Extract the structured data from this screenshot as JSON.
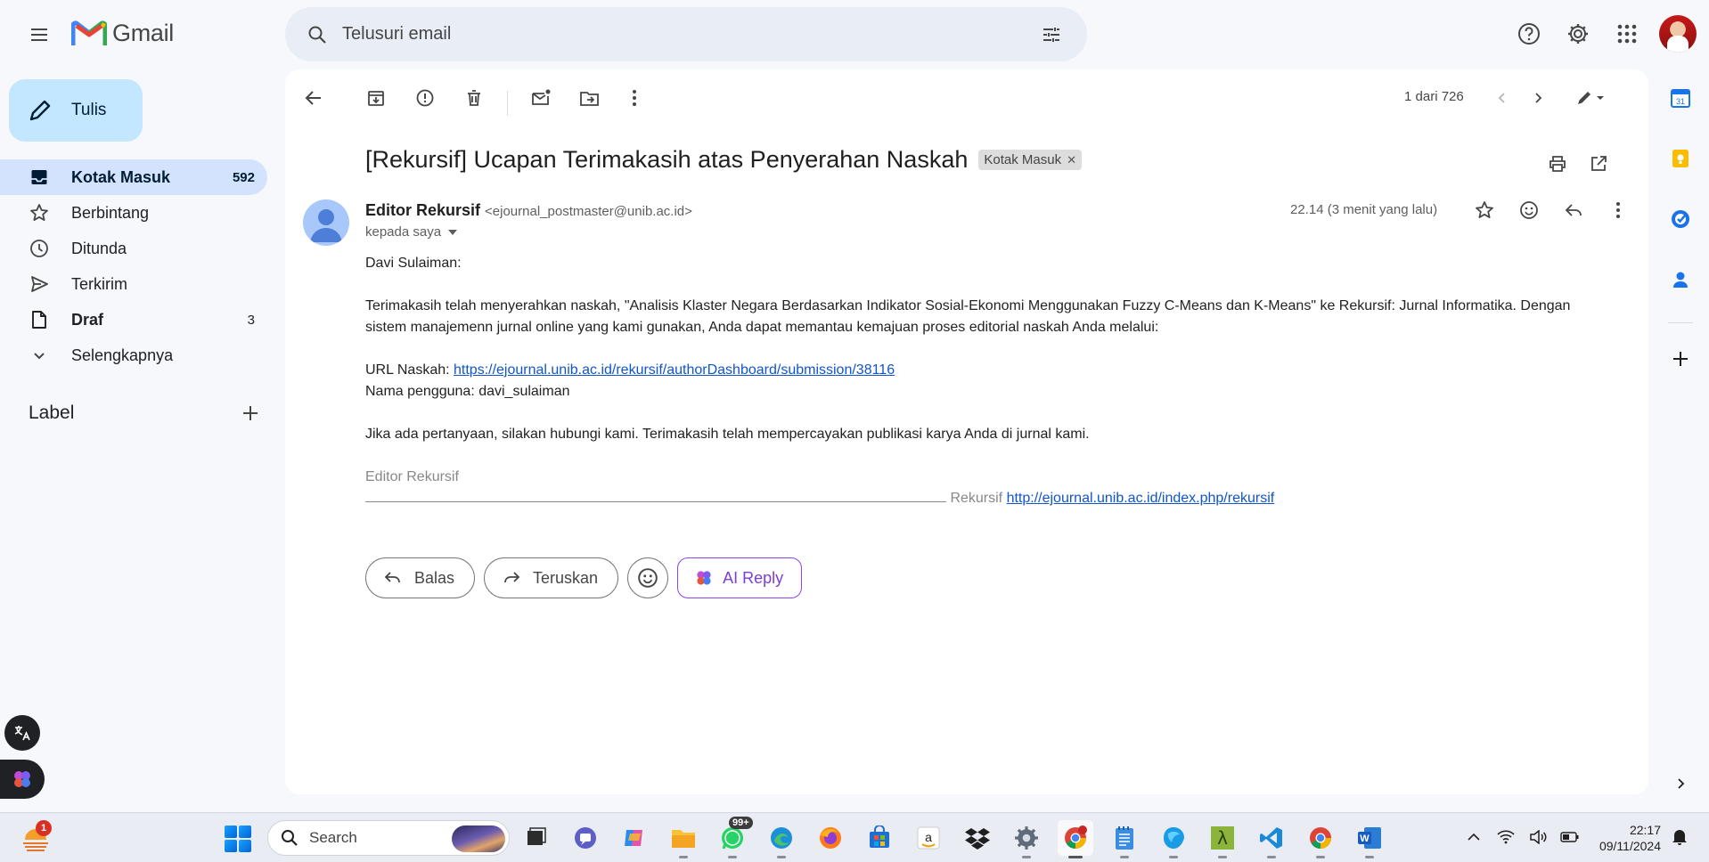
{
  "app": {
    "logo_text": "Gmail"
  },
  "search": {
    "placeholder": "Telusuri email"
  },
  "compose": {
    "label": "Tulis"
  },
  "sidebar": {
    "items": [
      {
        "label": "Kotak Masuk",
        "count": "592",
        "icon": "inbox-icon"
      },
      {
        "label": "Berbintang",
        "count": "",
        "icon": "star-icon"
      },
      {
        "label": "Ditunda",
        "count": "",
        "icon": "clock-icon"
      },
      {
        "label": "Terkirim",
        "count": "",
        "icon": "send-icon"
      },
      {
        "label": "Draf",
        "count": "3",
        "icon": "draft-icon"
      },
      {
        "label": "Selengkapnya",
        "count": "",
        "icon": "chevron-down-icon"
      }
    ],
    "label_header": "Label"
  },
  "toolbar": {
    "pager": "1 dari 726"
  },
  "email": {
    "subject": "[Rekursif] Ucapan Terimakasih atas Penyerahan Naskah",
    "label_chip": "Kotak Masuk",
    "sender_name": "Editor Rekursif",
    "sender_email": "<ejournal_postmaster@unib.ac.id>",
    "to": "kepada saya",
    "time": "22.14 (3 menit yang lalu)",
    "greeting": "Davi Sulaiman:",
    "paragraph1": "Terimakasih telah menyerahkan naskah, \"Analisis Klaster Negara Berdasarkan Indikator Sosial-Ekonomi Menggunakan Fuzzy C-Means dan K-Means\" ke Rekursif: Jurnal Informatika. Dengan sistem manajemenn jurnal online yang kami gunakan, Anda dapat memantau kemajuan proses editorial naskah Anda melalui:",
    "url_label": "URL Naskah: ",
    "url": "https://ejournal.unib.ac.id/rekursif/authorDashboard/submission/38116",
    "username_line": "Nama pengguna: davi_sulaiman",
    "paragraph2": "Jika ada pertanyaan, silakan hubungi kami. Terimakasih telah mempercayakan publikasi karya Anda di jurnal kami.",
    "signature": "Editor Rekursif",
    "footer_label": " Rekursif ",
    "footer_url": "http://ejournal.unib.ac.id/index.php/rekursif"
  },
  "reply_buttons": {
    "reply": "Balas",
    "forward": "Teruskan",
    "ai_reply": "AI Reply"
  },
  "taskbar": {
    "search_label": "Search",
    "weather_badge": "1",
    "whatsapp_badge": "99+",
    "time": "22:17",
    "date": "09/11/2024"
  },
  "colors": {
    "accent": "#0b57d0",
    "compose_bg": "#c2e7ff",
    "active_nav": "#d3e3fd",
    "link": "#1155cc"
  }
}
